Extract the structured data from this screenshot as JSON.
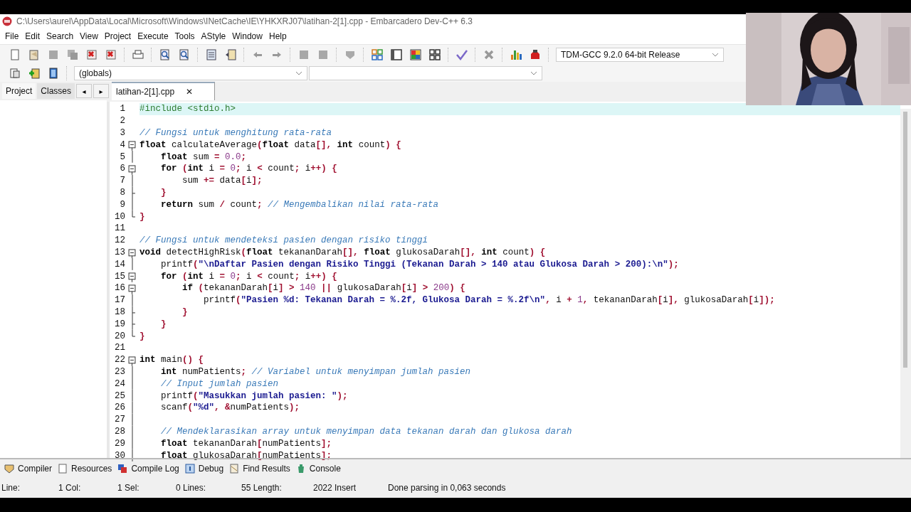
{
  "window": {
    "title": "C:\\Users\\aurel\\AppData\\Local\\Microsoft\\Windows\\INetCache\\IE\\YHKXRJ07\\latihan-2[1].cpp - Embarcadero Dev-C++ 6.3"
  },
  "menu": [
    "File",
    "Edit",
    "Search",
    "View",
    "Project",
    "Execute",
    "Tools",
    "AStyle",
    "Window",
    "Help"
  ],
  "compiler_select": {
    "value": "TDM-GCC 9.2.0 64-bit Release"
  },
  "scope_select": {
    "value": "(globals)"
  },
  "side_tabs": [
    {
      "label": "Project",
      "selected": true
    },
    {
      "label": "Classes",
      "selected": false
    }
  ],
  "side_nav": [
    "◂",
    "▸"
  ],
  "editor_tabs": [
    {
      "label": "latihan-2[1].cpp",
      "close": "✕",
      "selected": true
    }
  ],
  "code": [
    {
      "number": "1",
      "kind": "plain",
      "current": true,
      "tokens": [
        {
          "kind": "pre",
          "text": "#include <stdio.h>"
        }
      ]
    },
    {
      "number": "2",
      "kind": "plain",
      "current": false
    },
    {
      "number": "3",
      "kind": "plain",
      "current": false,
      "tokens": [
        {
          "kind": "com",
          "text": "// Fungsi untuk menghitung rata-rata"
        }
      ]
    },
    {
      "number": "4",
      "kind": "fold_start",
      "current": false,
      "tokens": [
        {
          "kind": "kw",
          "text": "float"
        },
        {
          "kind": "plain",
          "text": " calculateAverage"
        },
        {
          "kind": "sym",
          "text": "("
        },
        {
          "kind": "kw",
          "text": "float"
        },
        {
          "kind": "plain",
          "text": " data"
        },
        {
          "kind": "sym",
          "text": "[],"
        },
        {
          "kind": "kw",
          "text": " int"
        },
        {
          "kind": "plain",
          "text": " count"
        },
        {
          "kind": "sym",
          "text": ") {"
        }
      ]
    },
    {
      "number": "5",
      "kind": "fold_line",
      "current": false,
      "tokens": [
        {
          "kind": "kw",
          "text": "    float"
        },
        {
          "kind": "plain",
          "text": " sum "
        },
        {
          "kind": "sym",
          "text": "="
        },
        {
          "kind": "num",
          "text": " 0.0"
        },
        {
          "kind": "sym",
          "text": ";"
        }
      ]
    },
    {
      "number": "6",
      "kind": "fold_start",
      "current": false,
      "tokens": [
        {
          "kind": "kw",
          "text": "    for"
        },
        {
          "kind": "sym",
          "text": " ("
        },
        {
          "kind": "kw",
          "text": "int"
        },
        {
          "kind": "plain",
          "text": " i "
        },
        {
          "kind": "sym",
          "text": "="
        },
        {
          "kind": "num",
          "text": " 0"
        },
        {
          "kind": "sym",
          "text": ";"
        },
        {
          "kind": "plain",
          "text": " i "
        },
        {
          "kind": "sym",
          "text": "<"
        },
        {
          "kind": "plain",
          "text": " count"
        },
        {
          "kind": "sym",
          "text": ";"
        },
        {
          "kind": "plain",
          "text": " i"
        },
        {
          "kind": "sym",
          "text": "++) {"
        }
      ]
    },
    {
      "number": "7",
      "kind": "fold_line",
      "current": false,
      "tokens": [
        {
          "kind": "plain",
          "text": "        sum "
        },
        {
          "kind": "sym",
          "text": "+="
        },
        {
          "kind": "plain",
          "text": " data"
        },
        {
          "kind": "sym",
          "text": "["
        },
        {
          "kind": "plain",
          "text": "i"
        },
        {
          "kind": "sym",
          "text": "];"
        }
      ]
    },
    {
      "number": "8",
      "kind": "fold_branch",
      "current": false,
      "tokens": [
        {
          "kind": "sym",
          "text": "    }"
        }
      ]
    },
    {
      "number": "9",
      "kind": "fold_line",
      "current": false,
      "tokens": [
        {
          "kind": "kw",
          "text": "    return"
        },
        {
          "kind": "plain",
          "text": " sum "
        },
        {
          "kind": "sym",
          "text": "/"
        },
        {
          "kind": "plain",
          "text": " count"
        },
        {
          "kind": "sym",
          "text": ";"
        },
        {
          "kind": "com",
          "text": " // Mengembalikan nilai rata-rata"
        }
      ]
    },
    {
      "number": "10",
      "kind": "fold_end",
      "current": false,
      "tokens": [
        {
          "kind": "sym",
          "text": "}"
        }
      ]
    },
    {
      "number": "11",
      "kind": "plain",
      "current": false
    },
    {
      "number": "12",
      "kind": "plain",
      "current": false,
      "tokens": [
        {
          "kind": "com",
          "text": "// Fungsi untuk mendeteksi pasien dengan risiko tinggi"
        }
      ]
    },
    {
      "number": "13",
      "kind": "fold_start",
      "current": false,
      "tokens": [
        {
          "kind": "kw",
          "text": "void"
        },
        {
          "kind": "plain",
          "text": " detectHighRisk"
        },
        {
          "kind": "sym",
          "text": "("
        },
        {
          "kind": "kw",
          "text": "float"
        },
        {
          "kind": "plain",
          "text": " tekananDarah"
        },
        {
          "kind": "sym",
          "text": "[],"
        },
        {
          "kind": "kw",
          "text": " float"
        },
        {
          "kind": "plain",
          "text": " glukosaDarah"
        },
        {
          "kind": "sym",
          "text": "[],"
        },
        {
          "kind": "kw",
          "text": " int"
        },
        {
          "kind": "plain",
          "text": " count"
        },
        {
          "kind": "sym",
          "text": ") {"
        }
      ]
    },
    {
      "number": "14",
      "kind": "fold_line",
      "current": false,
      "tokens": [
        {
          "kind": "plain",
          "text": "    printf"
        },
        {
          "kind": "sym",
          "text": "("
        },
        {
          "kind": "str",
          "text": "\"\\nDaftar Pasien dengan Risiko Tinggi (Tekanan Darah > 140 atau Glukosa Darah > 200):\\n\""
        },
        {
          "kind": "sym",
          "text": ");"
        }
      ]
    },
    {
      "number": "15",
      "kind": "fold_start",
      "current": false,
      "tokens": [
        {
          "kind": "kw",
          "text": "    for"
        },
        {
          "kind": "sym",
          "text": " ("
        },
        {
          "kind": "kw",
          "text": "int"
        },
        {
          "kind": "plain",
          "text": " i "
        },
        {
          "kind": "sym",
          "text": "="
        },
        {
          "kind": "num",
          "text": " 0"
        },
        {
          "kind": "sym",
          "text": ";"
        },
        {
          "kind": "plain",
          "text": " i "
        },
        {
          "kind": "sym",
          "text": "<"
        },
        {
          "kind": "plain",
          "text": " count"
        },
        {
          "kind": "sym",
          "text": ";"
        },
        {
          "kind": "plain",
          "text": " i"
        },
        {
          "kind": "sym",
          "text": "++) {"
        }
      ]
    },
    {
      "number": "16",
      "kind": "fold_start",
      "current": false,
      "tokens": [
        {
          "kind": "kw",
          "text": "        if"
        },
        {
          "kind": "sym",
          "text": " ("
        },
        {
          "kind": "plain",
          "text": "tekananDarah"
        },
        {
          "kind": "sym",
          "text": "["
        },
        {
          "kind": "plain",
          "text": "i"
        },
        {
          "kind": "sym",
          "text": "] >"
        },
        {
          "kind": "num",
          "text": " 140"
        },
        {
          "kind": "sym",
          "text": " ||"
        },
        {
          "kind": "plain",
          "text": " glukosaDarah"
        },
        {
          "kind": "sym",
          "text": "["
        },
        {
          "kind": "plain",
          "text": "i"
        },
        {
          "kind": "sym",
          "text": "] >"
        },
        {
          "kind": "num",
          "text": " 200"
        },
        {
          "kind": "sym",
          "text": ") {"
        }
      ]
    },
    {
      "number": "17",
      "kind": "fold_line",
      "current": false,
      "tokens": [
        {
          "kind": "plain",
          "text": "            printf"
        },
        {
          "kind": "sym",
          "text": "("
        },
        {
          "kind": "str",
          "text": "\"Pasien %d: Tekanan Darah = %.2f, Glukosa Darah = %.2f\\n\""
        },
        {
          "kind": "sym",
          "text": ","
        },
        {
          "kind": "plain",
          "text": " i "
        },
        {
          "kind": "sym",
          "text": "+"
        },
        {
          "kind": "num",
          "text": " 1"
        },
        {
          "kind": "sym",
          "text": ","
        },
        {
          "kind": "plain",
          "text": " tekananDarah"
        },
        {
          "kind": "sym",
          "text": "["
        },
        {
          "kind": "plain",
          "text": "i"
        },
        {
          "kind": "sym",
          "text": "],"
        },
        {
          "kind": "plain",
          "text": " glukosaDarah"
        },
        {
          "kind": "sym",
          "text": "["
        },
        {
          "kind": "plain",
          "text": "i"
        },
        {
          "kind": "sym",
          "text": "]);"
        }
      ]
    },
    {
      "number": "18",
      "kind": "fold_branch",
      "current": false,
      "tokens": [
        {
          "kind": "sym",
          "text": "        }"
        }
      ]
    },
    {
      "number": "19",
      "kind": "fold_branch",
      "current": false,
      "tokens": [
        {
          "kind": "sym",
          "text": "    }"
        }
      ]
    },
    {
      "number": "20",
      "kind": "fold_end",
      "current": false,
      "tokens": [
        {
          "kind": "sym",
          "text": "}"
        }
      ]
    },
    {
      "number": "21",
      "kind": "plain",
      "current": false
    },
    {
      "number": "22",
      "kind": "fold_start",
      "current": false,
      "tokens": [
        {
          "kind": "kw",
          "text": "int"
        },
        {
          "kind": "plain",
          "text": " main"
        },
        {
          "kind": "sym",
          "text": "() {"
        }
      ]
    },
    {
      "number": "23",
      "kind": "fold_line",
      "current": false,
      "tokens": [
        {
          "kind": "kw",
          "text": "    int"
        },
        {
          "kind": "plain",
          "text": " numPatients"
        },
        {
          "kind": "sym",
          "text": ";"
        },
        {
          "kind": "com",
          "text": " // Variabel untuk menyimpan jumlah pasien"
        }
      ]
    },
    {
      "number": "24",
      "kind": "fold_line",
      "current": false,
      "tokens": [
        {
          "kind": "com",
          "text": "    // Input jumlah pasien"
        }
      ]
    },
    {
      "number": "25",
      "kind": "fold_line",
      "current": false,
      "tokens": [
        {
          "kind": "plain",
          "text": "    printf"
        },
        {
          "kind": "sym",
          "text": "("
        },
        {
          "kind": "str",
          "text": "\"Masukkan jumlah pasien: \""
        },
        {
          "kind": "sym",
          "text": ");"
        }
      ]
    },
    {
      "number": "26",
      "kind": "fold_line",
      "current": false,
      "tokens": [
        {
          "kind": "plain",
          "text": "    scanf"
        },
        {
          "kind": "sym",
          "text": "("
        },
        {
          "kind": "str",
          "text": "\"%d\""
        },
        {
          "kind": "sym",
          "text": ", &"
        },
        {
          "kind": "plain",
          "text": "numPatients"
        },
        {
          "kind": "sym",
          "text": ");"
        }
      ]
    },
    {
      "number": "27",
      "kind": "fold_line",
      "current": false
    },
    {
      "number": "28",
      "kind": "fold_line",
      "current": false,
      "tokens": [
        {
          "kind": "com",
          "text": "    // Mendeklarasikan array untuk menyimpan data tekanan darah dan glukosa darah"
        }
      ]
    },
    {
      "number": "29",
      "kind": "fold_line",
      "current": false,
      "tokens": [
        {
          "kind": "kw",
          "text": "    float"
        },
        {
          "kind": "plain",
          "text": " tekananDarah"
        },
        {
          "kind": "sym",
          "text": "["
        },
        {
          "kind": "plain",
          "text": "numPatients"
        },
        {
          "kind": "sym",
          "text": "];"
        }
      ]
    },
    {
      "number": "30",
      "kind": "fold_line",
      "current": false,
      "tokens": [
        {
          "kind": "kw",
          "text": "    float"
        },
        {
          "kind": "plain",
          "text": " glukosaDarah"
        },
        {
          "kind": "sym",
          "text": "["
        },
        {
          "kind": "plain",
          "text": "numPatients"
        },
        {
          "kind": "sym",
          "text": "];"
        }
      ]
    }
  ],
  "bottom_tabs": [
    {
      "label": "Compiler",
      "kind": "compiler"
    },
    {
      "label": "Resources",
      "kind": "resources"
    },
    {
      "label": "Compile Log",
      "kind": "log"
    },
    {
      "label": "Debug",
      "kind": "debug"
    },
    {
      "label": "Find Results",
      "kind": "find"
    },
    {
      "label": "Console",
      "kind": "console"
    }
  ],
  "status_bar": [
    "Line:",
    "1 Col:",
    "1 Sel:",
    "0 Lines:",
    "55 Length:",
    "2022 Insert",
    "Done parsing in 0,063 seconds"
  ],
  "webcam": {
    "kind": "picture"
  }
}
